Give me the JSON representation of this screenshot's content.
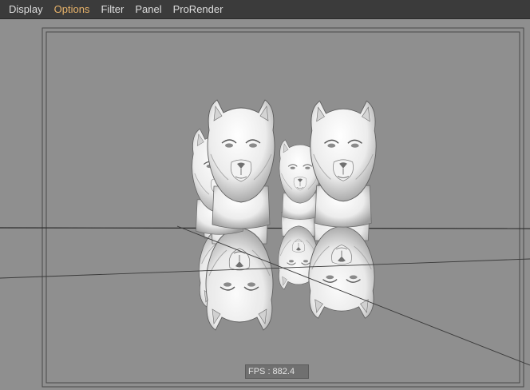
{
  "menubar": {
    "items": [
      {
        "label": "Display",
        "active": false
      },
      {
        "label": "Options",
        "active": true
      },
      {
        "label": "Filter",
        "active": false
      },
      {
        "label": "Panel",
        "active": false
      },
      {
        "label": "ProRender",
        "active": false
      }
    ]
  },
  "viewport": {
    "fps_label": "FPS : 882.4",
    "background_color": "#8f8f8f",
    "active_menu_color": "#e8b36a"
  }
}
